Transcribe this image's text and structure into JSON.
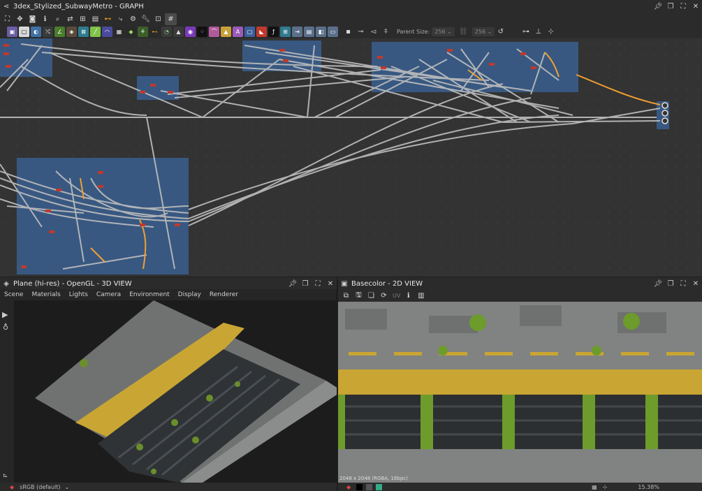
{
  "graph_panel": {
    "title": "3dex_Stylized_SubwayMetro - GRAPH",
    "icon": "graph-icon",
    "controls": [
      "pin-icon",
      "restore-icon",
      "maximize-icon",
      "close-icon"
    ],
    "toolbar": {
      "parent_size_label": "Parent Size:",
      "parent_size_value": "256",
      "size_value_2": "256",
      "node_colors": {
        "red": "#c0392b",
        "orange": "#f39c12",
        "node_frame": "#3a5f8f",
        "link": "#bfbfbf"
      }
    }
  },
  "view3d_panel": {
    "title": "Plane (hi-res) - OpenGL - 3D VIEW",
    "icon": "cube-icon",
    "menu": [
      "Scene",
      "Materials",
      "Lights",
      "Camera",
      "Environment",
      "Display",
      "Renderer"
    ],
    "colorspace": "sRGB (default)"
  },
  "view2d_panel": {
    "title": "Basecolor - 2D VIEW",
    "icon": "image-icon",
    "uv_label": "UV",
    "resolution_info": "2048 x 2048 (RGBA, 16bpc)",
    "zoom": "15.38%"
  }
}
